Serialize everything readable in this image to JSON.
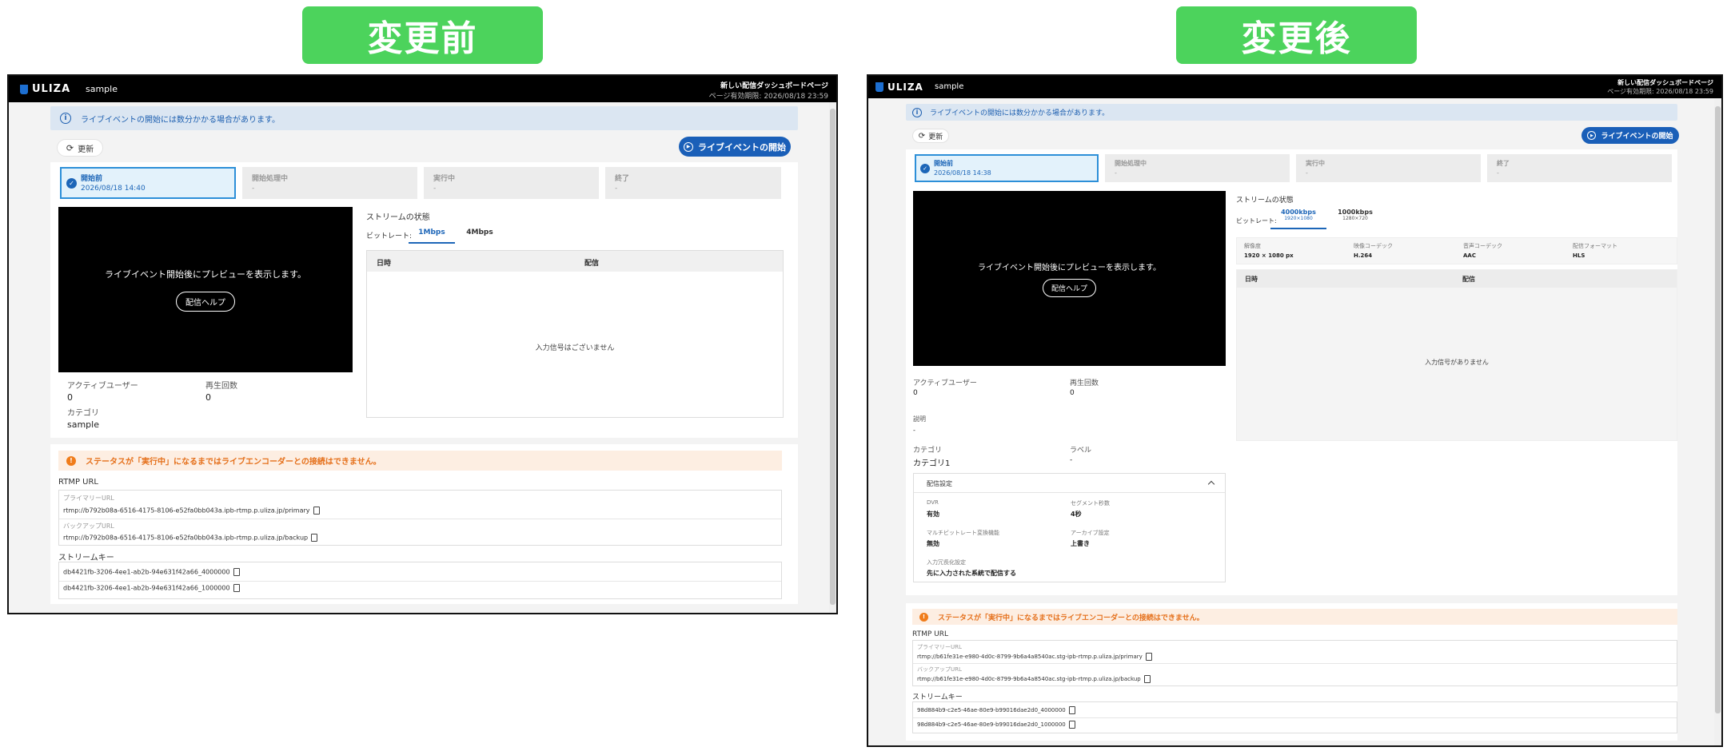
{
  "captions": {
    "before": "変更前",
    "after": "変更後"
  },
  "app": {
    "logo": "ULIZA",
    "name": "sample",
    "page_title": "新しい配信ダッシュボードページ",
    "expiry": "ページ有効期限: 2026/08/18 23:59"
  },
  "colors": {
    "caption_bg": "#4cd35c",
    "primary": "#1a5fb8",
    "warning": "#f07c1a",
    "info_bg": "#dbe6f2"
  },
  "common": {
    "info_notice": "ライブイベントの開始には数分かかる場合があります。",
    "refresh": "更新",
    "start_button": "ライブイベントの開始",
    "steps": [
      "開始前",
      "開始処理中",
      "実行中",
      "終了"
    ],
    "step_placeholder": "-",
    "preview_text": "ライブイベント開始後にプレビューを表示します。",
    "help_button": "配信ヘルプ",
    "stream_status": "ストリームの状態",
    "bitrate_label": "ビットレート:",
    "col_datetime": "日時",
    "col_delivery": "配信",
    "active_users": "アクティブユーザー",
    "play_count": "再生回数",
    "category": "カテゴリ",
    "warning": "ステータスが「実行中」になるまではライブエンコーダーとの接続はできません。",
    "rtmp_url": "RTMP URL",
    "primary_url": "プライマリーURL",
    "backup_url": "バックアップURL",
    "stream_key": "ストリームキー"
  },
  "before": {
    "date": "2026/08/18 14:40",
    "tabs": [
      "1Mbps",
      "4Mbps"
    ],
    "empty": "入力信号はございません",
    "active_users": "0",
    "play_count": "0",
    "category": "sample",
    "primary": "rtmp://b792b08a-6516-4175-8106-e52fa0bb043a.ipb-rtmp.p.uliza.jp/primary",
    "backup": "rtmp://b792b08a-6516-4175-8106-e52fa0bb043a.ipb-rtmp.p.uliza.jp/backup",
    "keys": [
      "db4421fb-3206-4ee1-ab2b-94e631f42a66_4000000",
      "db4421fb-3206-4ee1-ab2b-94e631f42a66_1000000"
    ]
  },
  "after": {
    "date": "2026/08/18 14:38",
    "tabs": [
      {
        "label": "4000kbps",
        "sub": "1920×1080"
      },
      {
        "label": "1000kbps",
        "sub": "1280×720"
      }
    ],
    "specs": [
      {
        "k": "解像度",
        "v": "1920 × 1080 px"
      },
      {
        "k": "映像コーデック",
        "v": "H.264"
      },
      {
        "k": "音声コーデック",
        "v": "AAC"
      },
      {
        "k": "配信フォーマット",
        "v": "HLS"
      }
    ],
    "empty": "入力信号がありません",
    "active_users": "0",
    "play_count": "0",
    "description_label": "説明",
    "description": "-",
    "category": "カテゴリ1",
    "label_label": "ラベル",
    "label": "-",
    "settings_title": "配信設定",
    "settings": [
      {
        "k": "DVR",
        "v": "有効"
      },
      {
        "k": "セグメント秒数",
        "v": "4秒"
      },
      {
        "k": "マルチビットレート変換機能",
        "v": "無効"
      },
      {
        "k": "アーカイブ設定",
        "v": "上書き"
      },
      {
        "k": "入力冗長化設定",
        "v": "先に入力された系統で配信する"
      }
    ],
    "primary": "rtmp://b61fe31e-e980-4d0c-8799-9b6a4a8540ac.stg-ipb-rtmp.p.uliza.jp/primary",
    "backup": "rtmp://b61fe31e-e980-4d0c-8799-9b6a4a8540ac.stg-ipb-rtmp.p.uliza.jp/backup",
    "keys": [
      "98d884b9-c2e5-46ae-80e9-b99016dae2d0_4000000",
      "98d884b9-c2e5-46ae-80e9-b99016dae2d0_1000000"
    ]
  }
}
